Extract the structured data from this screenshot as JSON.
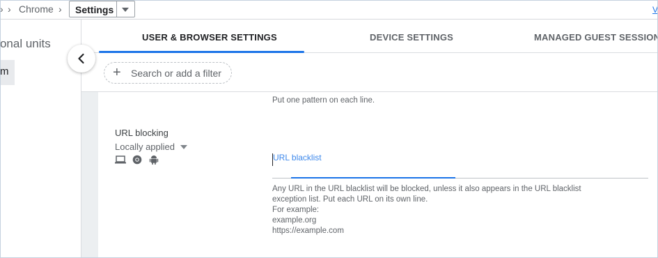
{
  "breadcrumb": {
    "partial_first_sep": "›",
    "chrome_label": "Chrome",
    "current_label": "Settings",
    "right_link_partial": "V"
  },
  "left_panel": {
    "title_partial": "ational units",
    "selected_item_partial": "m"
  },
  "tabs": [
    {
      "label": "USER & BROWSER SETTINGS",
      "active": true
    },
    {
      "label": "DEVICE SETTINGS",
      "active": false
    },
    {
      "label": "MANAGED GUEST SESSION SE",
      "active": false
    }
  ],
  "filter": {
    "placeholder": "Search or add a filter"
  },
  "content": {
    "top_hint": "Put one pattern on each line.",
    "setting": {
      "name": "URL blocking",
      "applied_status": "Locally applied",
      "platform_icons": [
        "laptop-icon",
        "chrome-icon",
        "android-icon"
      ]
    },
    "field": {
      "label": "URL blacklist",
      "value": ""
    },
    "help_lines": [
      "Any URL in the URL blacklist will be blocked, unless it also appears in the URL blacklist",
      "exception list. Put each URL on its own line.",
      "For example:",
      "example.org",
      "https://example.com"
    ]
  },
  "colors": {
    "accent": "#1a73e8",
    "content_bg": "#eceff1",
    "text_primary": "#202124",
    "text_secondary": "#5f6368"
  }
}
